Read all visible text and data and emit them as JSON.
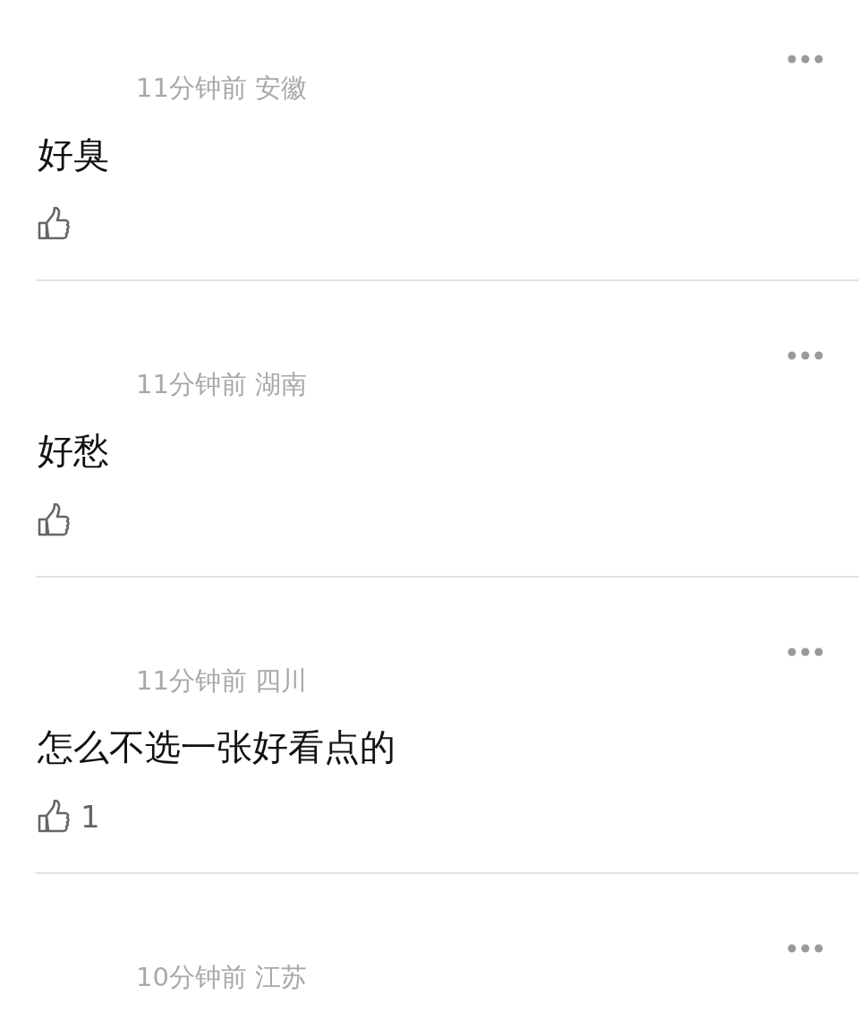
{
  "comments": [
    {
      "kind": "full",
      "meta": "11分钟前 安徽",
      "text": "好臭"
    },
    {
      "kind": "full",
      "meta": "11分钟前 湖南",
      "text": "好愁"
    },
    {
      "kind": "full",
      "meta": "11分钟前 四川",
      "text": "怎么不选一张好看点的",
      "like_count": "1"
    },
    {
      "kind": "partial",
      "meta": "10分钟前 江苏"
    }
  ]
}
